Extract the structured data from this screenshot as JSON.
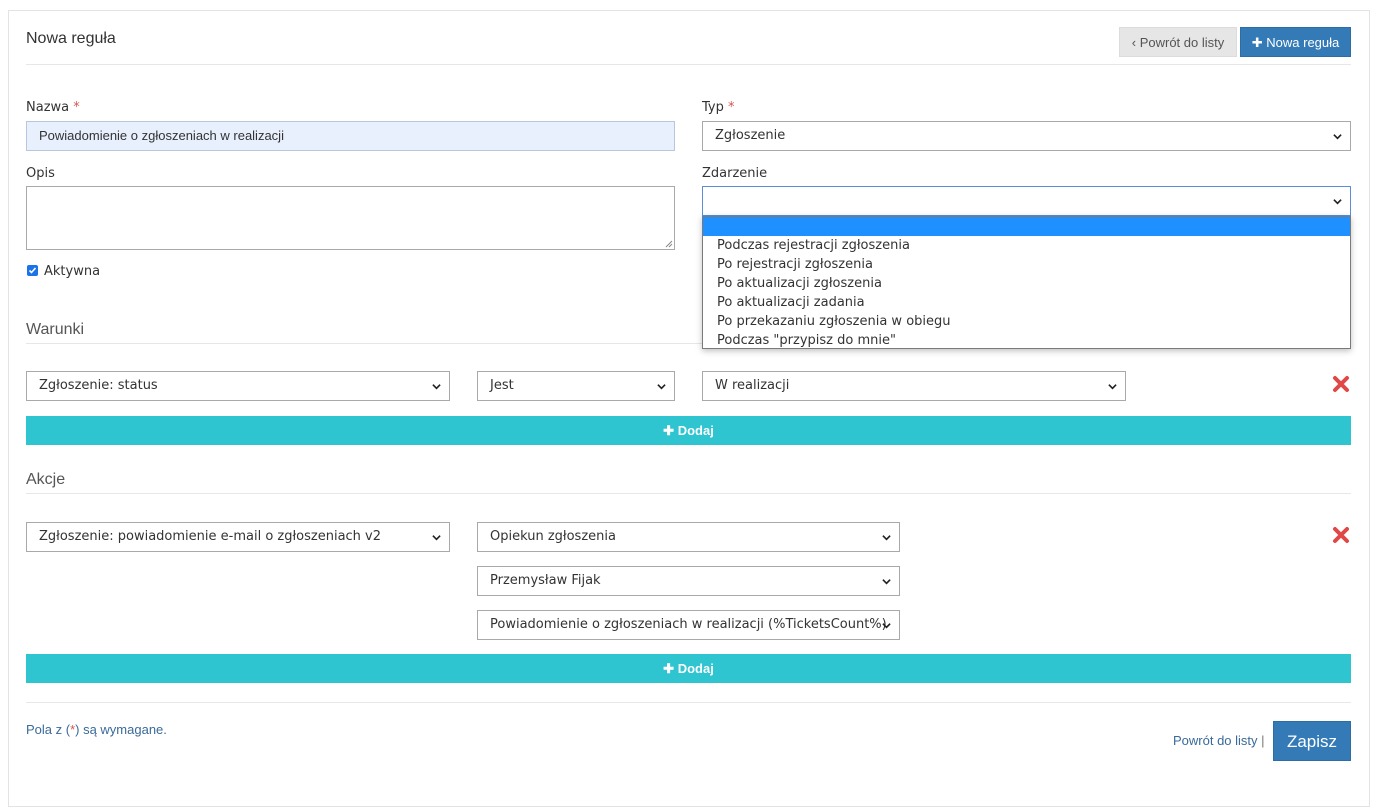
{
  "header": {
    "title": "Nowa reguła",
    "back_button": "Powrót do listy",
    "new_button": "Nowa reguła",
    "back_chevron": "‹",
    "plus_glyph": "✚"
  },
  "form": {
    "name_label": "Nazwa",
    "required_mark": "*",
    "name_value": "Powiadomienie o zgłoszeniach w realizacji",
    "type_label": "Typ",
    "type_value": "Zgłoszenie",
    "description_label": "Opis",
    "description_value": "",
    "event_label": "Zdarzenie",
    "event_value": "",
    "active_label": "Aktywna",
    "active_checked": true
  },
  "event_dropdown": {
    "options": [
      "",
      "Podczas rejestracji zgłoszenia",
      "Po rejestracji zgłoszenia",
      "Po aktualizacji zgłoszenia",
      "Po aktualizacji zadania",
      "Po przekazaniu zgłoszenia w obiegu",
      "Podczas \"przypisz do mnie\""
    ],
    "highlighted_index": 0
  },
  "conditions": {
    "title": "Warunki",
    "field": "Zgłoszenie: status",
    "operator": "Jest",
    "value": "W realizacji",
    "add_label": "Dodaj"
  },
  "actions": {
    "title": "Akcje",
    "action": "Zgłoszenie: powiadomienie e-mail o zgłoszeniach v2",
    "param1": "Opiekun zgłoszenia",
    "param2": "Przemysław Fijak",
    "param3": "Powiadomienie o zgłoszeniach w realizacji (%TicketsCount%)",
    "add_label": "Dodaj"
  },
  "footer": {
    "note_prefix": "Pola z (",
    "note_mark": "*",
    "note_suffix": ") są wymagane.",
    "back_link": "Powrót do listy",
    "separator": "|",
    "save_button": "Zapisz"
  },
  "colors": {
    "primary": "#337ab7",
    "accent": "#2ec4d0",
    "danger": "#e04848",
    "required": "#d9534f"
  },
  "icons": {
    "delete": "close-icon",
    "dropdown": "chevron-down-icon",
    "add": "plus-icon"
  }
}
